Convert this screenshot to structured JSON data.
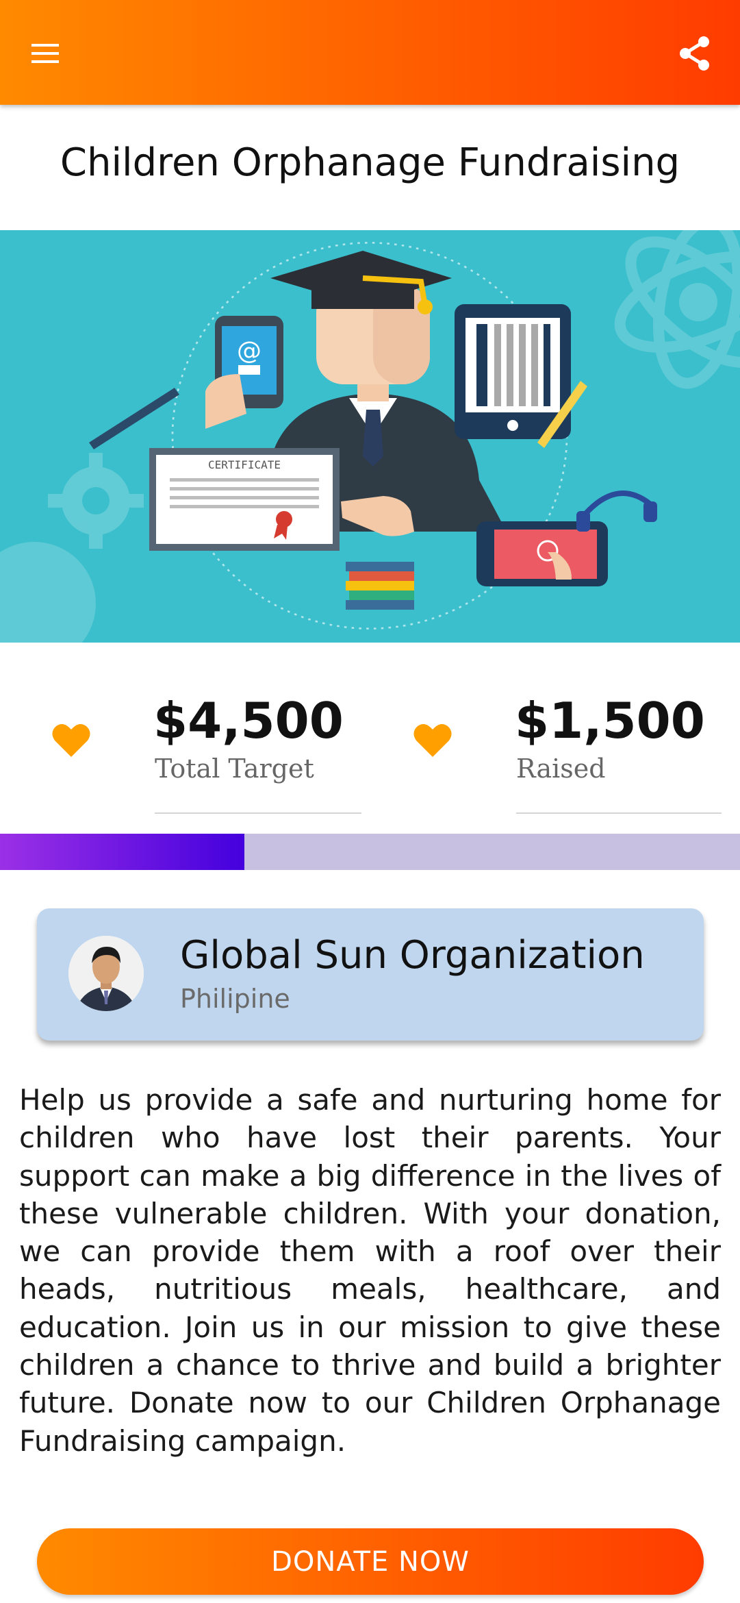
{
  "header": {
    "menu_icon": "menu-icon",
    "share_icon": "share-icon"
  },
  "campaign": {
    "title": "Children Orphanage Fundraising",
    "image_certificate_text": "CERTIFICATE"
  },
  "stats": {
    "target_amount": "$4,500",
    "target_label": "Total Target",
    "raised_amount": "$1,500",
    "raised_label": "Raised",
    "progress_fraction": 0.33,
    "heart_color": "#ffa000"
  },
  "organization": {
    "name": "Global Sun Organization",
    "location": "Philipine"
  },
  "description": "Help us provide a safe and nurturing home for children who have lost their parents. Your support can make a big difference in the lives of these vulnerable children. With your donation, we can provide them with a roof over their heads, nutritious meals, healthcare, and education. Join us in our mission to give these children a chance to thrive and build a brighter future. Donate now to our Children Orphanage Fundraising campaign.",
  "actions": {
    "donate_label": "DONATE NOW"
  },
  "colors": {
    "accent_start": "#ff8a00",
    "accent_end": "#ff3c00",
    "progress_start": "#9b30e6",
    "progress_end": "#4400dd",
    "progress_track": "#c7c0e0",
    "card_bg": "#bfd6ee",
    "hero_bg": "#3bbfcc"
  }
}
